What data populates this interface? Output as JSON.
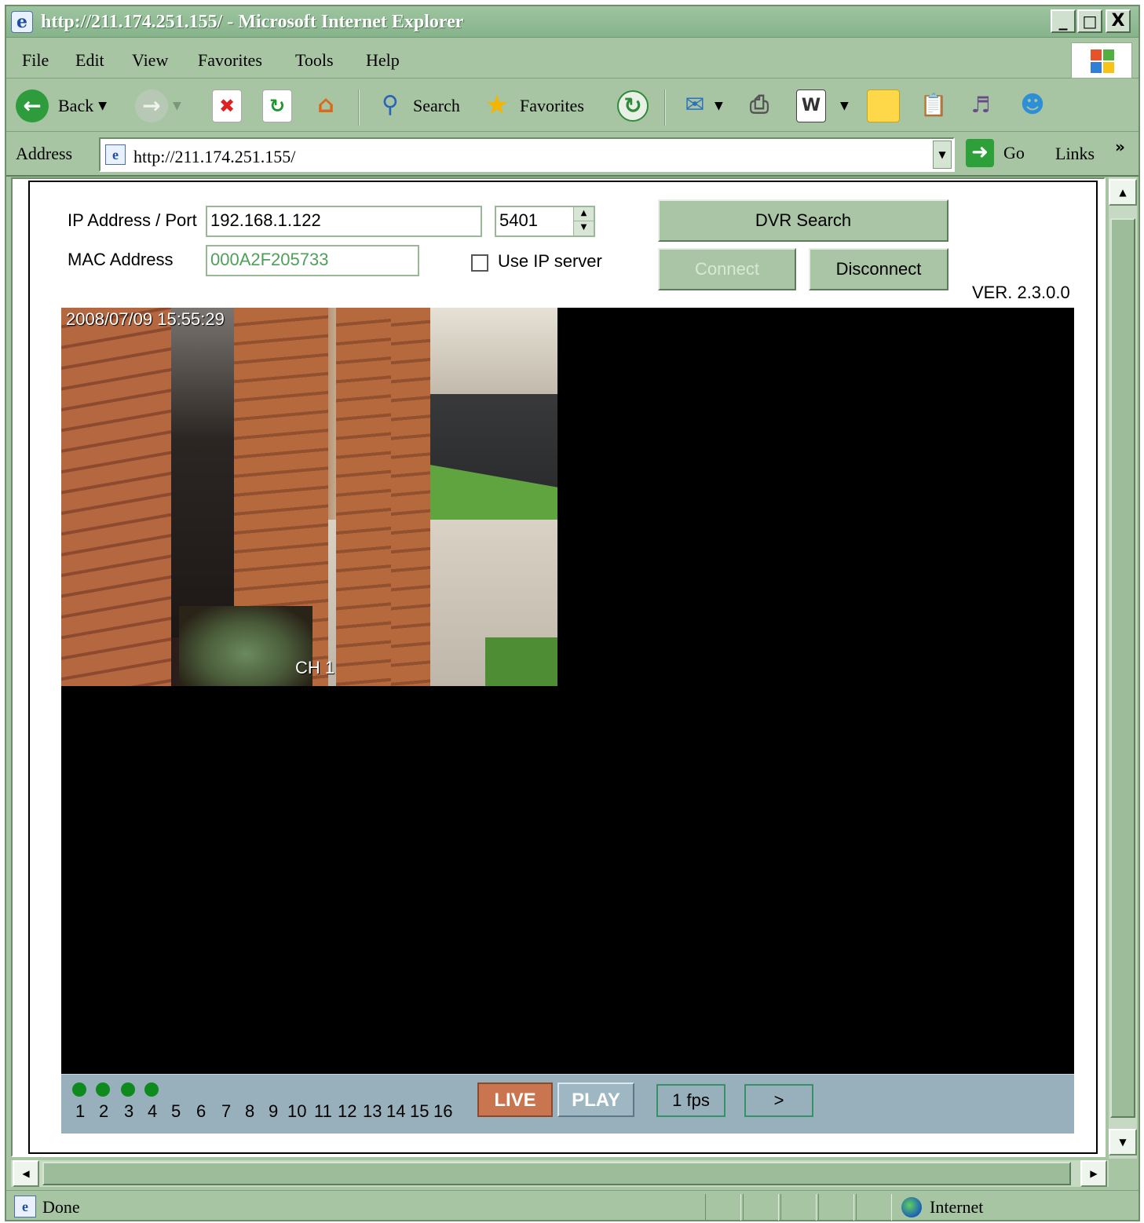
{
  "window": {
    "title": "http://211.174.251.155/ - Microsoft Internet Explorer",
    "minimize": "_",
    "maximize": "□",
    "close": "X"
  },
  "menu": {
    "items": [
      {
        "label": "File"
      },
      {
        "label": "Edit"
      },
      {
        "label": "View"
      },
      {
        "label": "Favorites"
      },
      {
        "label": "Tools"
      },
      {
        "label": "Help"
      }
    ]
  },
  "toolbar": {
    "back": "Back",
    "search": "Search",
    "favorites": "Favorites"
  },
  "address": {
    "label": "Address",
    "url": "http://211.174.251.155/",
    "go": "Go",
    "links": "Links",
    "more": "»"
  },
  "dvr": {
    "ip_label": "IP Address / Port",
    "ip_value": "192.168.1.122",
    "port_value": "5401",
    "mac_label": "MAC Address",
    "mac_value": "000A2F205733",
    "use_ip_server": "Use IP server",
    "use_ip_server_checked": false,
    "dvr_search": "DVR Search",
    "connect": "Connect",
    "disconnect": "Disconnect",
    "version": "VER. 2.3.0.0",
    "timestamp": "2008/07/09  15:55:29",
    "channel_label": "CH 1",
    "channels": [
      "1",
      "2",
      "3",
      "4",
      "5",
      "6",
      "7",
      "8",
      "9",
      "10",
      "11",
      "12",
      "13",
      "14",
      "15",
      "16"
    ],
    "active_channels": 4,
    "live": "LIVE",
    "play": "PLAY",
    "fps": "1 fps",
    "next": ">"
  },
  "status": {
    "text": "Done",
    "zone": "Internet"
  }
}
